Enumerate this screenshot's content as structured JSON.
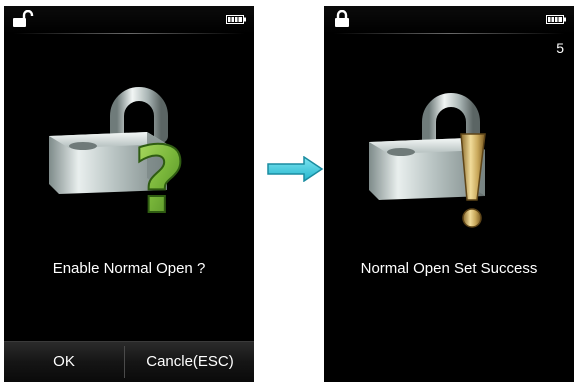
{
  "screens": [
    {
      "status": {
        "lock_icon": "unlocked-padlock-icon",
        "battery_icon": "battery-full-icon"
      },
      "illustration": {
        "icon": "padlock-question-mark-icon"
      },
      "message": "Enable Normal Open ?",
      "softkeys": {
        "ok": "OK",
        "cancel": "Cancle(ESC)"
      }
    },
    {
      "status": {
        "lock_icon": "locked-padlock-icon",
        "battery_icon": "battery-full-icon"
      },
      "countdown": "5",
      "illustration": {
        "icon": "padlock-exclamation-icon"
      },
      "message": "Normal Open Set Success"
    }
  ],
  "transition": {
    "icon": "right-arrow-icon",
    "color": "#35c8dc"
  },
  "colors": {
    "question_mark": "#79b63a",
    "exclamation": "#c8a75a",
    "screen_background": "#000000",
    "text": "#ffffff"
  }
}
